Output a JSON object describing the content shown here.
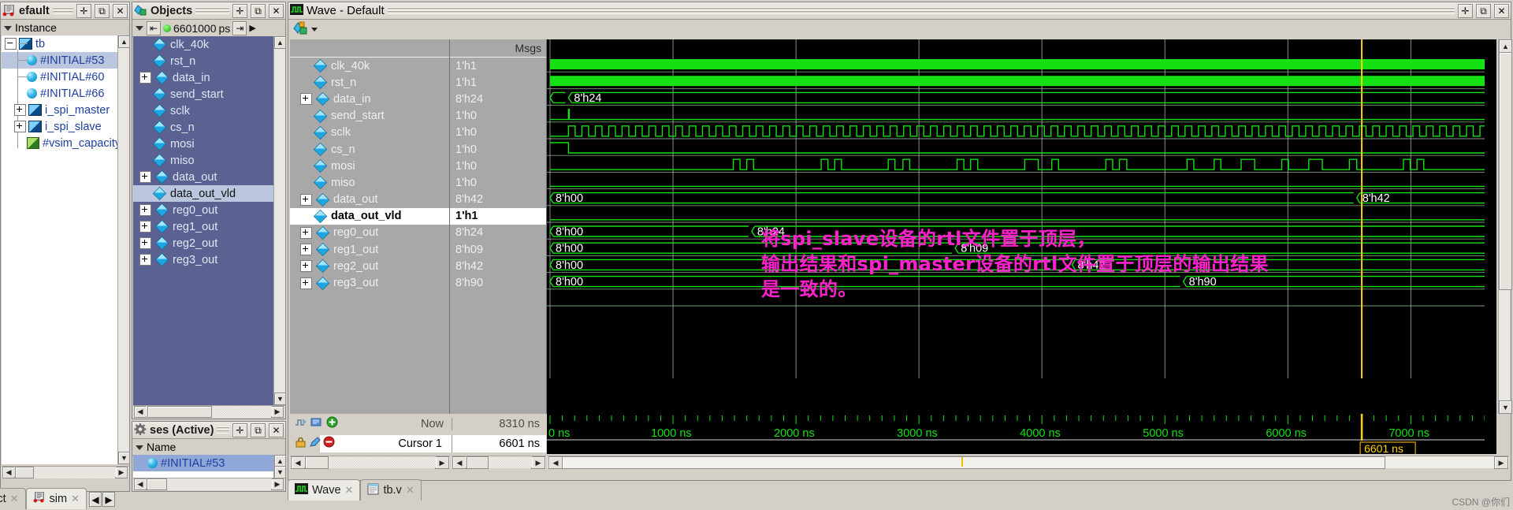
{
  "instance_panel": {
    "title": "efault",
    "column_header": "Instance",
    "buttons": [
      "+",
      "undock",
      "x"
    ],
    "rows": [
      {
        "label": "tb",
        "icon": "module-icon",
        "depth": 0,
        "expander": "minus",
        "selected": false
      },
      {
        "label": "#INITIAL#53",
        "icon": "process-icon",
        "depth": 1,
        "expander": "none",
        "selected": true
      },
      {
        "label": "#INITIAL#60",
        "icon": "process-icon",
        "depth": 1,
        "expander": "none",
        "selected": false
      },
      {
        "label": "#INITIAL#66",
        "icon": "process-icon",
        "depth": 1,
        "expander": "none",
        "selected": false
      },
      {
        "label": "i_spi_master",
        "icon": "module-icon",
        "depth": 1,
        "expander": "plus",
        "selected": false
      },
      {
        "label": "i_spi_slave",
        "icon": "module-icon",
        "depth": 1,
        "expander": "plus",
        "selected": false
      },
      {
        "label": "#vsim_capacity#",
        "icon": "capacity-icon",
        "depth": 1,
        "expander": "none",
        "selected": false
      }
    ]
  },
  "objects_panel": {
    "title": "Objects",
    "time_value": "6601000",
    "time_unit": "ps",
    "items": [
      {
        "label": "clk_40k",
        "expandable": false,
        "selected": false
      },
      {
        "label": "rst_n",
        "expandable": false,
        "selected": false
      },
      {
        "label": "data_in",
        "expandable": true,
        "selected": false
      },
      {
        "label": "send_start",
        "expandable": false,
        "selected": false
      },
      {
        "label": "sclk",
        "expandable": false,
        "selected": false
      },
      {
        "label": "cs_n",
        "expandable": false,
        "selected": false
      },
      {
        "label": "mosi",
        "expandable": false,
        "selected": false
      },
      {
        "label": "miso",
        "expandable": false,
        "selected": false
      },
      {
        "label": "data_out",
        "expandable": true,
        "selected": false
      },
      {
        "label": "data_out_vld",
        "expandable": false,
        "selected": true
      },
      {
        "label": "reg0_out",
        "expandable": true,
        "selected": false
      },
      {
        "label": "reg1_out",
        "expandable": true,
        "selected": false
      },
      {
        "label": "reg2_out",
        "expandable": true,
        "selected": false
      },
      {
        "label": "reg3_out",
        "expandable": true,
        "selected": false
      }
    ]
  },
  "processes_panel": {
    "title": "ses (Active)",
    "column_header": "Name",
    "rows": [
      {
        "label": "#INITIAL#53"
      }
    ]
  },
  "wave_panel": {
    "title": "Wave - Default",
    "msgs_header": "Msgs",
    "signals": [
      {
        "name": "clk_40k",
        "value": "1'h1",
        "expandable": false,
        "selected": false,
        "kind": "clock-fast"
      },
      {
        "name": "rst_n",
        "value": "1'h1",
        "expandable": false,
        "selected": false,
        "kind": "high"
      },
      {
        "name": "data_in",
        "value": "8'h24",
        "expandable": true,
        "selected": false,
        "kind": "bus",
        "segments": [
          {
            "label": "",
            "start": 0,
            "end": 150
          },
          {
            "label": "8'h24",
            "start": 150,
            "end": 8310
          }
        ]
      },
      {
        "name": "send_start",
        "value": "1'h0",
        "expandable": false,
        "selected": false,
        "kind": "pulse-early"
      },
      {
        "name": "sclk",
        "value": "1'h0",
        "expandable": false,
        "selected": false,
        "kind": "clock-slow"
      },
      {
        "name": "cs_n",
        "value": "1'h0",
        "expandable": false,
        "selected": false,
        "kind": "cs"
      },
      {
        "name": "mosi",
        "value": "1'h0",
        "expandable": false,
        "selected": false,
        "kind": "mosi"
      },
      {
        "name": "miso",
        "value": "1'h0",
        "expandable": false,
        "selected": false,
        "kind": "low"
      },
      {
        "name": "data_out",
        "value": "8'h42",
        "expandable": true,
        "selected": false,
        "kind": "bus",
        "segments": [
          {
            "label": "8'h00",
            "start": 0,
            "end": 6560
          },
          {
            "label": "8'h42",
            "start": 6560,
            "end": 8310
          }
        ]
      },
      {
        "name": "data_out_vld",
        "value": "1'h1",
        "expandable": false,
        "selected": true,
        "kind": "low"
      },
      {
        "name": "reg0_out",
        "value": "8'h24",
        "expandable": true,
        "selected": false,
        "kind": "bus",
        "segments": [
          {
            "label": "8'h00",
            "start": 0,
            "end": 1640
          },
          {
            "label": "8'h24",
            "start": 1640,
            "end": 8310
          }
        ]
      },
      {
        "name": "reg1_out",
        "value": "8'h09",
        "expandable": true,
        "selected": false,
        "kind": "bus",
        "segments": [
          {
            "label": "8'h00",
            "start": 0,
            "end": 3295
          },
          {
            "label": "8'h09",
            "start": 3295,
            "end": 8310
          }
        ]
      },
      {
        "name": "reg2_out",
        "value": "8'h42",
        "expandable": true,
        "selected": false,
        "kind": "bus",
        "segments": [
          {
            "label": "8'h00",
            "start": 0,
            "end": 4245
          },
          {
            "label": "8'h42",
            "start": 4245,
            "end": 8310
          }
        ]
      },
      {
        "name": "reg3_out",
        "value": "8'h90",
        "expandable": true,
        "selected": false,
        "kind": "bus",
        "segments": [
          {
            "label": "8'h00",
            "start": 0,
            "end": 5150
          },
          {
            "label": "8'h90",
            "start": 5150,
            "end": 8310
          }
        ]
      }
    ],
    "now_label": "Now",
    "now_value": "8310 ns",
    "cursor_label": "Cursor 1",
    "cursor_value": "6601 ns",
    "cursor_marker": "6601 ns",
    "cursor_time_ns": 6601,
    "time_axis": {
      "ticks": [
        "0 ns",
        "1000 ns",
        "2000 ns",
        "3000 ns",
        "4000 ns",
        "5000 ns",
        "6000 ns",
        "7000 ns"
      ],
      "min_ns": 0,
      "max_ns": 7600
    }
  },
  "annotation": {
    "color": "#ff22cc",
    "lines": [
      "将spi_slave设备的rtl文件置于顶层，",
      "输出结果和spi_master设备的rtl文件置于顶层的输出结果",
      "是一致的。"
    ]
  },
  "bottom_tabs": {
    "left": [
      {
        "label": "oject",
        "active": false,
        "closable": true
      },
      {
        "label": "sim",
        "active": true,
        "closable": true
      }
    ],
    "wave": [
      {
        "label": "Wave",
        "active": true,
        "closable": true,
        "icon": "wave-icon"
      },
      {
        "label": "tb.v",
        "active": false,
        "closable": true,
        "icon": "file-icon"
      }
    ]
  },
  "watermark": "CSDN @你们"
}
